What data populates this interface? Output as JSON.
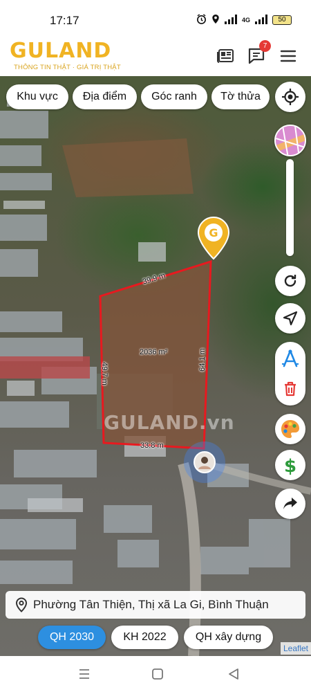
{
  "status_bar": {
    "time": "17:17",
    "network": "4G",
    "battery": "50",
    "icons": [
      "alarm-icon",
      "location-icon",
      "signal-icon",
      "battery-icon"
    ]
  },
  "header": {
    "logo": "GULAND",
    "tagline": "THÔNG TIN THẬT · GIÁ TRỊ THẬT",
    "notification_count": "7",
    "icons": [
      "news-icon",
      "chat-icon",
      "menu-icon"
    ]
  },
  "filters": [
    {
      "label": "Khu vực"
    },
    {
      "label": "Địa điểm"
    },
    {
      "label": "Góc ranh"
    },
    {
      "label": "Tờ thửa"
    }
  ],
  "parcel": {
    "area": "2036 m²",
    "edge_top": "39.9 m",
    "edge_right": "64.1 m",
    "edge_bottom": "33.8 m",
    "edge_left": "49.7 m",
    "watermark": "GULAND.vn",
    "outline_color": "#e8191f"
  },
  "controls": [
    "locate-icon",
    "layer-thumbnail",
    "refresh-icon",
    "navigate-icon",
    "measure-icon",
    "trash-icon",
    "palette-icon",
    "dollar-icon",
    "share-icon"
  ],
  "address": {
    "text": "Phường Tân Thiện, Thị xã La Gi, Bình Thuận"
  },
  "plan_tabs": [
    {
      "label": "QH 2030",
      "active": true
    },
    {
      "label": "KH 2022",
      "active": false
    },
    {
      "label": "QH xây dựng",
      "active": false
    }
  ],
  "attribution": "Leaflet",
  "nav_bar": [
    "recents-icon",
    "home-icon",
    "back-icon"
  ],
  "colors": {
    "brand": "#f0b323",
    "accent": "#2d8fe0",
    "parcel_outline": "#e8191f"
  }
}
